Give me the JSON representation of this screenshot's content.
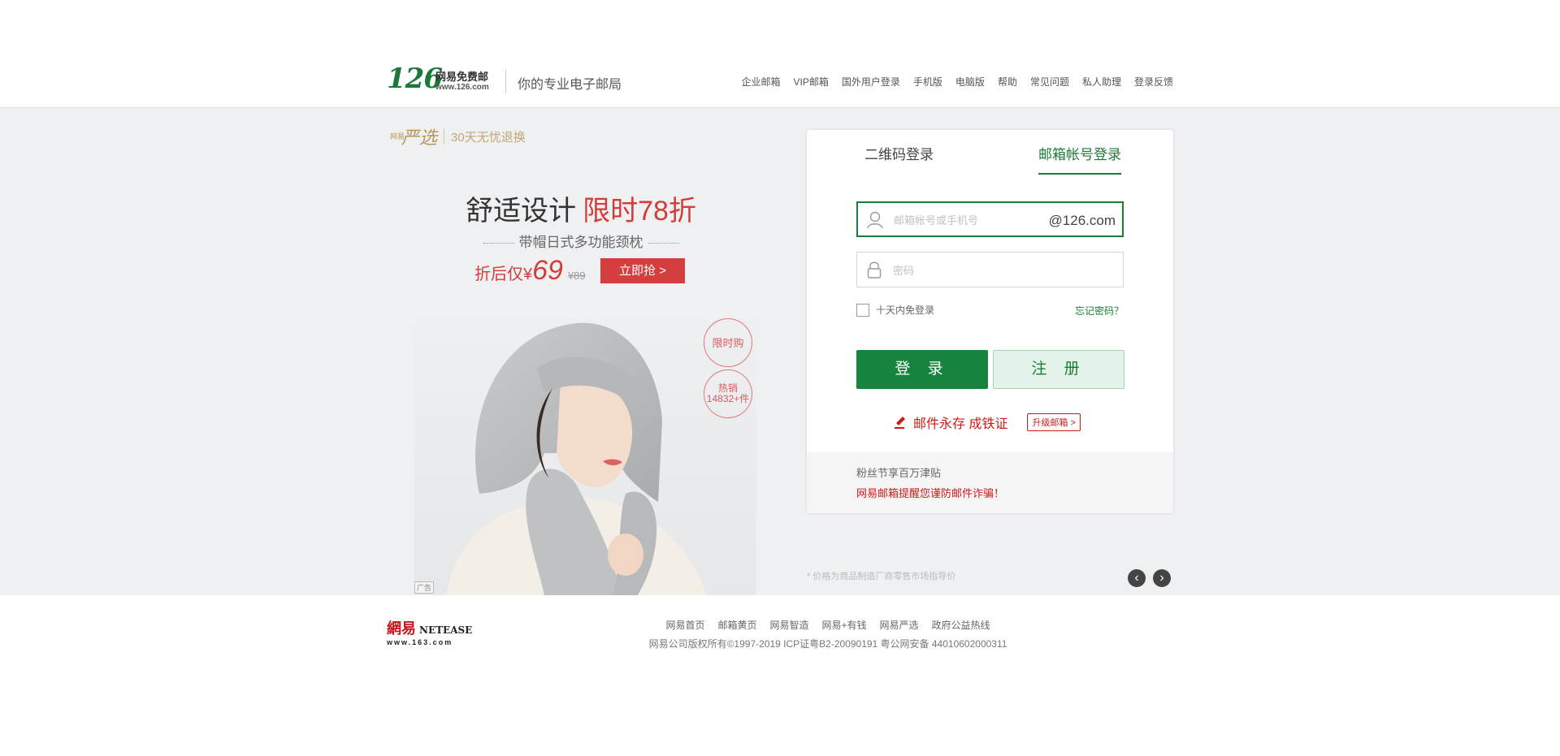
{
  "header": {
    "logo_number": "126",
    "logo_cn": "网易免费邮",
    "logo_url": "www.126.com",
    "slogan": "你的专业电子邮局",
    "nav": [
      "企业邮箱",
      "VIP邮箱",
      "国外用户登录",
      "手机版",
      "电脑版",
      "帮助",
      "常见问题",
      "私人助理",
      "登录反馈"
    ]
  },
  "promo": {
    "brand_small": "网易",
    "brand": "严选",
    "brand_tag": "30天无忧退换",
    "title_part1": "舒适设计",
    "title_part2": "限时78折",
    "subtitle": "带帽日式多功能颈枕",
    "price_prefix": "折后仅¥",
    "price": "69",
    "old_price": "¥89",
    "buy_label": "立即抢 >",
    "badge1": "限时购",
    "badge2_line1": "热销",
    "badge2_line2": "14832+件",
    "ad_mark": "广告",
    "disclaimer": "* 价格为商品制造厂商零售市场指导价"
  },
  "carousel": {
    "prev_icon": "chevron-left-icon",
    "next_icon": "chevron-right-icon"
  },
  "login": {
    "tab_qr": "二维码登录",
    "tab_account": "邮箱帐号登录",
    "username_placeholder": "邮箱帐号或手机号",
    "username_suffix": "@126.com",
    "password_placeholder": "密码",
    "remember_label": "十天内免登录",
    "forgot_label": "忘记密码？",
    "login_button": "登 录",
    "register_button": "注 册",
    "forever_text": "邮件永存 成铁证",
    "upgrade_label": "升级邮箱 >",
    "news1": "粉丝节享百万津贴",
    "news2": "网易邮箱提醒您谨防邮件诈骗！"
  },
  "footer": {
    "logo_cn": "網易",
    "logo_en": "NETEASE",
    "logo_url": "www.163.com",
    "links": [
      "网易首页",
      "邮箱黄页",
      "网易智造",
      "网易+有钱",
      "网易严选",
      "政府公益热线"
    ],
    "copyright": "网易公司版权所有©1997-2019   ICP证粤B2-20090191   粤公网安备 44010602000311"
  },
  "colors": {
    "brand_green": "#16843d",
    "promo_red": "#d43c3c",
    "banner_bg": "#eff0f2"
  }
}
